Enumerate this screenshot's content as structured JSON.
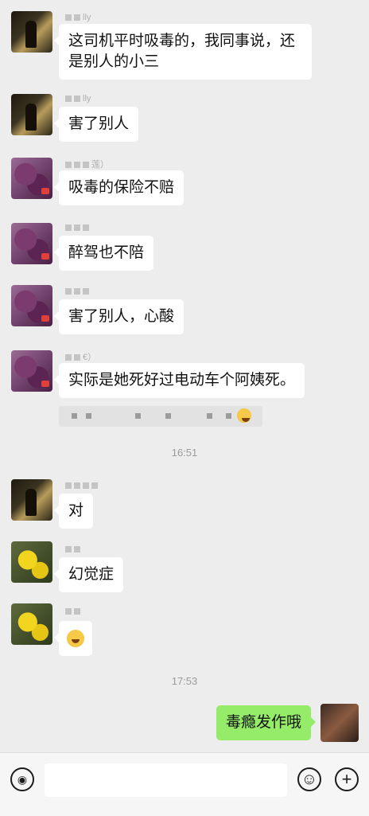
{
  "messages": [
    {
      "text": "这司机平时吸毒的，我同事说，还是别人的小三",
      "line1": "这司机平时吸毒的，我同事说，还",
      "line2": "是别人的小三"
    },
    {
      "text": "害了别人"
    },
    {
      "text": "吸毒的保险不赔"
    },
    {
      "text": "醉驾也不陪"
    },
    {
      "text": "害了别人，心酸"
    },
    {
      "text": "实际是她死好过电动车个阿姨死。"
    },
    {
      "text": "对"
    },
    {
      "text": "幻觉症"
    },
    {
      "text": "[emoji]"
    },
    {
      "text": "毒瘾发作哦"
    }
  ],
  "sender_fragments": [
    "lly",
    "lly",
    "莲）",
    "",
    "",
    "€）"
  ],
  "timestamps": [
    "16:51",
    "17:53"
  ],
  "input": {
    "placeholder": ""
  },
  "icons": {
    "voice": "voice-icon",
    "emoji": "emoji-icon",
    "plus": "plus-icon"
  }
}
